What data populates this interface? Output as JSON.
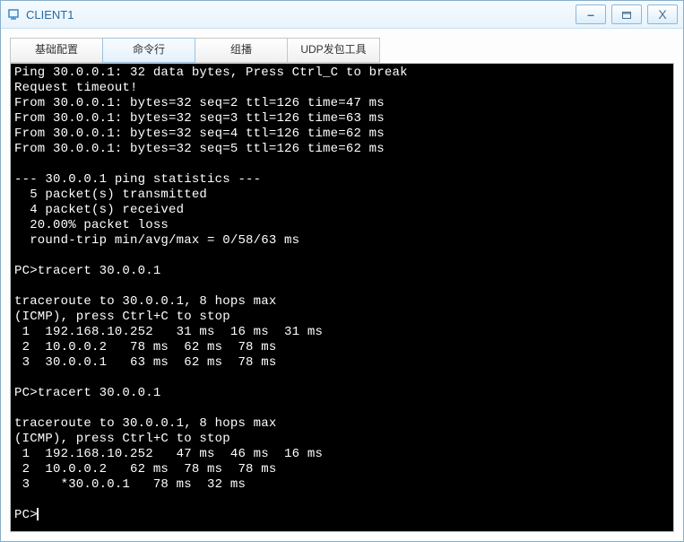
{
  "title": "CLIENT1",
  "tabs": {
    "basic": "基础配置",
    "cmd": "命令行",
    "multicast": "组播",
    "udp": "UDP发包工具"
  },
  "term": {
    "l0": "Ping 30.0.0.1: 32 data bytes, Press Ctrl_C to break",
    "l1": "Request timeout!",
    "l2": "From 30.0.0.1: bytes=32 seq=2 ttl=126 time=47 ms",
    "l3": "From 30.0.0.1: bytes=32 seq=3 ttl=126 time=63 ms",
    "l4": "From 30.0.0.1: bytes=32 seq=4 ttl=126 time=62 ms",
    "l5": "From 30.0.0.1: bytes=32 seq=5 ttl=126 time=62 ms",
    "l6": "",
    "l7": "--- 30.0.0.1 ping statistics ---",
    "l8": "  5 packet(s) transmitted",
    "l9": "  4 packet(s) received",
    "l10": "  20.00% packet loss",
    "l11": "  round-trip min/avg/max = 0/58/63 ms",
    "l12": "",
    "l13": "PC>tracert 30.0.0.1",
    "l14": "",
    "l15": "traceroute to 30.0.0.1, 8 hops max",
    "l16": "(ICMP), press Ctrl+C to stop",
    "l17": " 1  192.168.10.252   31 ms  16 ms  31 ms",
    "l18": " 2  10.0.0.2   78 ms  62 ms  78 ms",
    "l19": " 3  30.0.0.1   63 ms  62 ms  78 ms",
    "l20": "",
    "l21": "PC>tracert 30.0.0.1",
    "l22": "",
    "l23": "traceroute to 30.0.0.1, 8 hops max",
    "l24": "(ICMP), press Ctrl+C to stop",
    "l25": " 1  192.168.10.252   47 ms  46 ms  16 ms",
    "l26": " 2  10.0.0.2   62 ms  78 ms  78 ms",
    "l27": " 3    *30.0.0.1   78 ms  32 ms",
    "l28": "",
    "prompt": "PC>"
  }
}
